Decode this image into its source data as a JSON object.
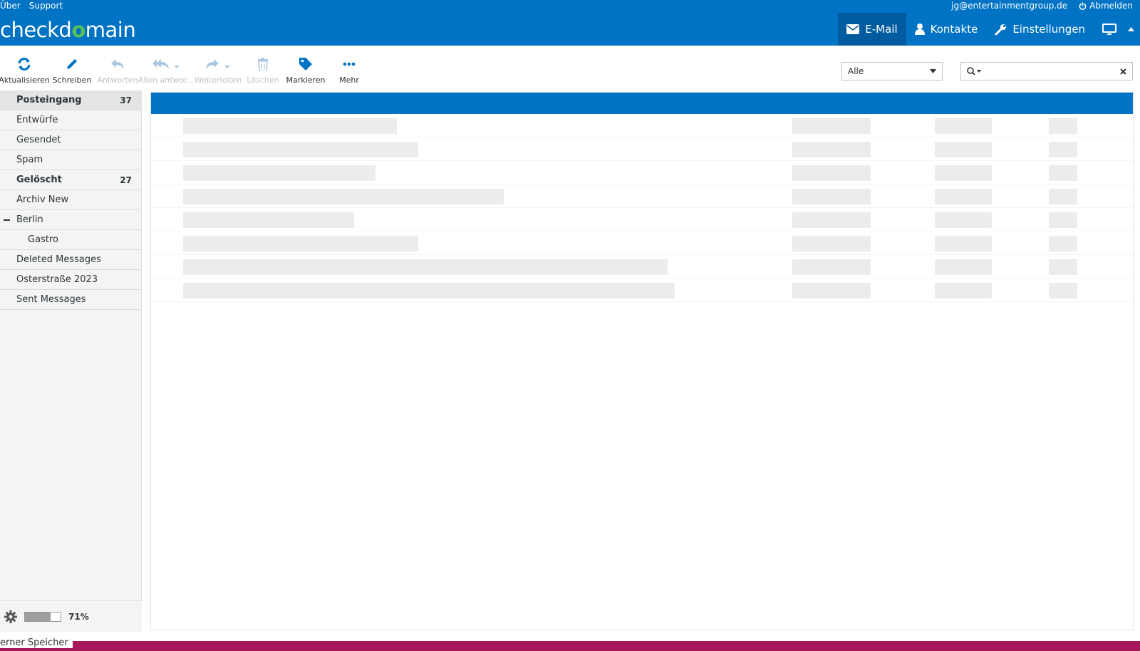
{
  "header": {
    "links": [
      "Über",
      "Support"
    ],
    "user": "jg@entertainmentgroup.de",
    "logout": "Abmelden",
    "logo_pre": "checkd",
    "logo_mark": "o",
    "logo_post": "main",
    "tasks": [
      {
        "label": "E-Mail",
        "icon": "envelope-icon",
        "selected": true
      },
      {
        "label": "Kontakte",
        "icon": "user-icon"
      },
      {
        "label": "Einstellungen",
        "icon": "wrench-icon"
      }
    ]
  },
  "toolbar": {
    "buttons": [
      {
        "label": "Aktualisieren",
        "icon": "refresh-icon",
        "enabled": true
      },
      {
        "label": "Schreiben",
        "icon": "pencil-icon",
        "enabled": true
      },
      {
        "label": "Antworten",
        "icon": "reply-icon",
        "enabled": false
      },
      {
        "label": "Allen antwor...",
        "icon": "reply-all-icon",
        "enabled": false
      },
      {
        "label": "Weiterleiten",
        "icon": "forward-icon",
        "enabled": false
      },
      {
        "label": "Löschen",
        "icon": "trash-icon",
        "enabled": false
      },
      {
        "label": "Markieren",
        "icon": "tag-icon",
        "enabled": true
      },
      {
        "label": "Mehr",
        "icon": "more-icon",
        "enabled": true
      }
    ],
    "filter_value": "Alle",
    "search_value": ""
  },
  "folders": [
    {
      "name": "Posteingang",
      "count": "37",
      "bold": true,
      "selected": true
    },
    {
      "name": "Entwürfe"
    },
    {
      "name": "Gesendet"
    },
    {
      "name": "Spam"
    },
    {
      "name": "Gelöscht",
      "count": "27",
      "bold": true
    },
    {
      "name": "Archiv New"
    },
    {
      "name": "Berlin",
      "collapsible": true
    },
    {
      "name": "Gastro",
      "sub": true
    },
    {
      "name": "Deleted Messages"
    },
    {
      "name": "Osterstraße 2023"
    },
    {
      "name": "Sent Messages"
    }
  ],
  "quota": {
    "percent": 71,
    "label": "71%"
  },
  "colors": {
    "brand": "#0073c5",
    "selected_task": "#005b9f",
    "accent": "#57c05a"
  },
  "bottom_text": "erner Speicher"
}
